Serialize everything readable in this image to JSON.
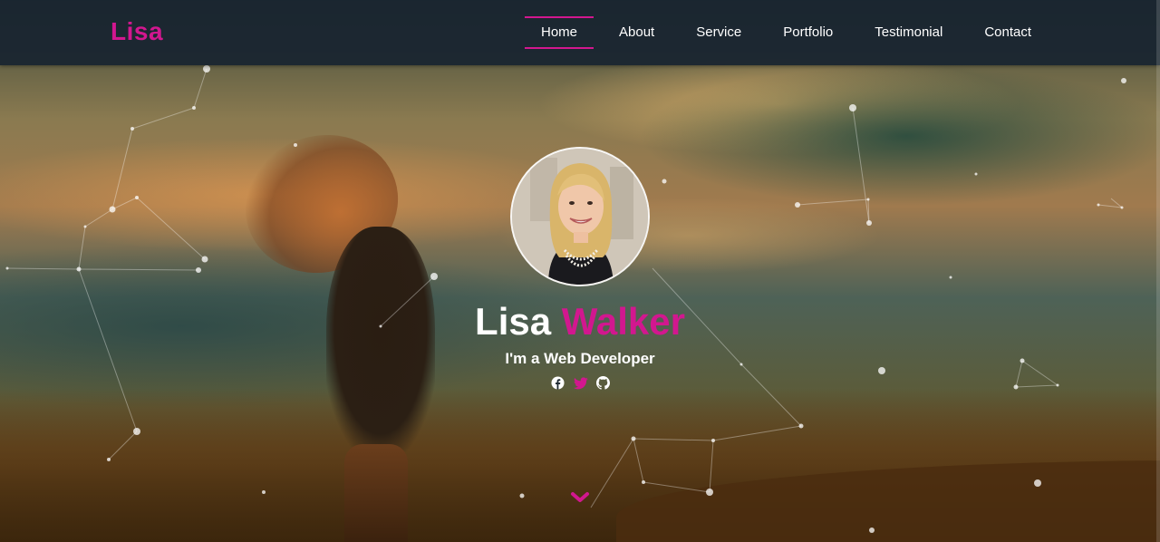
{
  "navbar": {
    "brand": "Lisa",
    "links": [
      "Home",
      "About",
      "Service",
      "Portfolio",
      "Testimonial",
      "Contact"
    ],
    "active_link": "Home"
  },
  "hero": {
    "first_name": "Lisa",
    "last_name": "Walker",
    "tagline_prefix": "I'm a",
    "tagline_role": "Web Developer",
    "socials": [
      "facebook-icon",
      "twitter-icon",
      "github-icon"
    ],
    "scroll_icon": "chevron-down-icon"
  },
  "colors": {
    "accent": "#d2178f",
    "navbar_bg": "#182430",
    "text": "#ffffff"
  }
}
